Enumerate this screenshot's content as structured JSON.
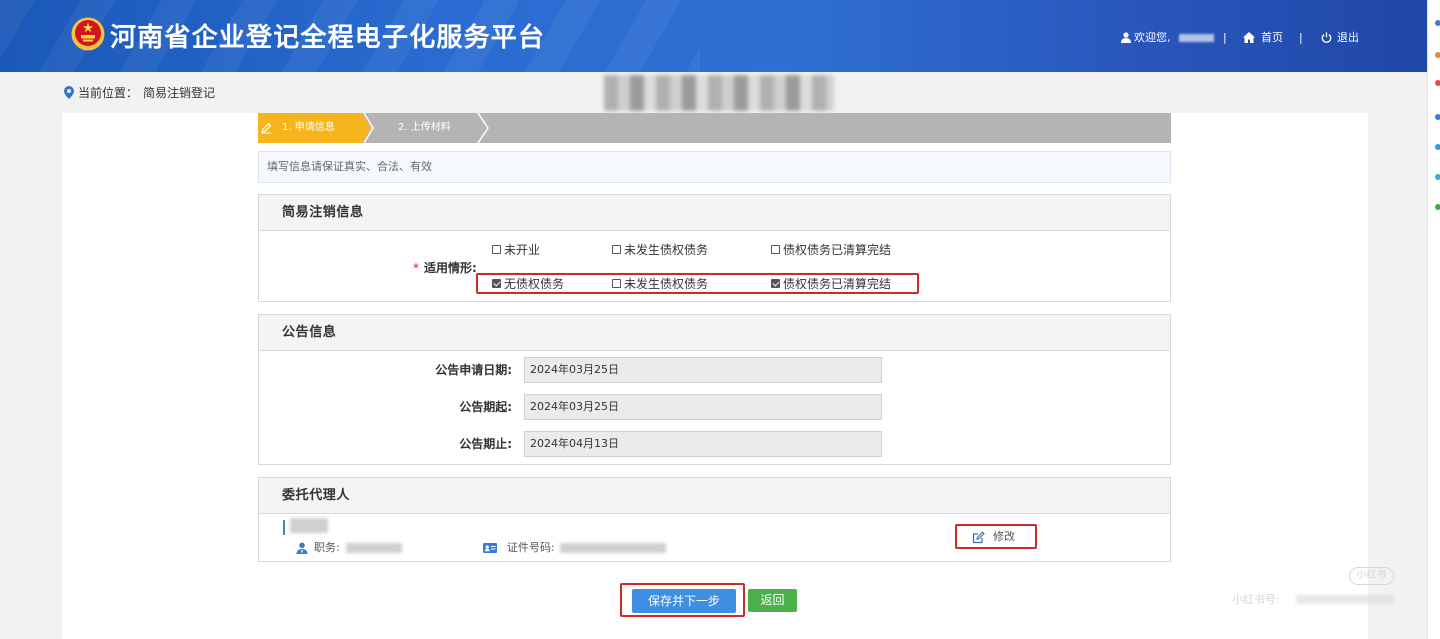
{
  "header": {
    "title": "河南省企业登记全程电子化服务平台",
    "welcome": "欢迎您,",
    "separator": "|",
    "home": "首页",
    "logout": "退出"
  },
  "breadcrumb": {
    "label": "当前位置：",
    "current": "简易注销登记"
  },
  "steps": [
    {
      "label": "1. 申请信息",
      "active": true
    },
    {
      "label": "2. 上传材料",
      "active": false
    }
  ],
  "notice": "填写信息请保证真实、合法、有效",
  "cancellation": {
    "title": "简易注销信息",
    "required_mark": "*",
    "field_label": "适用情形:",
    "rows": [
      [
        {
          "label": "未开业",
          "checked": false
        },
        {
          "label": "未发生债权债务",
          "checked": false
        },
        {
          "label": "债权债务已清算完结",
          "checked": false
        }
      ],
      [
        {
          "label": "无债权债务",
          "checked": true
        },
        {
          "label": "未发生债权债务",
          "checked": false
        },
        {
          "label": "债权债务已清算完结",
          "checked": true
        }
      ]
    ]
  },
  "announcement": {
    "title": "公告信息",
    "fields": [
      {
        "label": "公告申请日期:",
        "value": "2024年03月25日"
      },
      {
        "label": "公告期起:",
        "value": "2024年03月25日"
      },
      {
        "label": "公告期止:",
        "value": "2024年04月13日"
      }
    ]
  },
  "agent": {
    "title": "委托代理人",
    "position_label": "职务:",
    "id_label": "证件号码:",
    "edit_label": "修改"
  },
  "buttons": {
    "save_next": "保存并下一步",
    "back": "返回"
  },
  "watermark": {
    "badge": "小红书",
    "account_label": "小红书号:"
  },
  "icons": {
    "emblem": "national-emblem-icon",
    "user": "user-icon",
    "home": "home-icon",
    "logout": "power-icon",
    "location": "location-pin-icon",
    "step_edit": "pencil-icon",
    "position": "person-icon",
    "id": "id-card-icon",
    "edit": "edit-icon"
  },
  "colors": {
    "header_blue": "#2a6cd2",
    "step_active": "#f6b51d",
    "primary_button": "#3e8fe3",
    "back_button": "#4cb04a",
    "highlight_red": "#cc2b2b"
  }
}
